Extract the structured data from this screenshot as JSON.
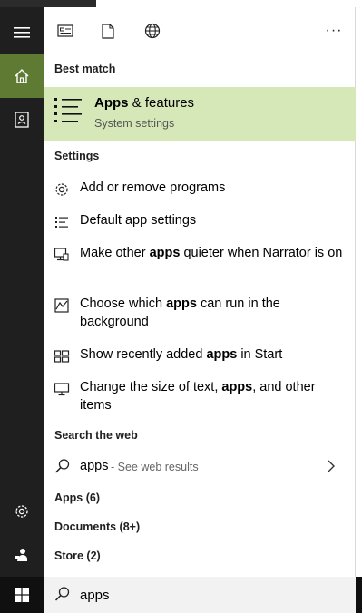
{
  "toolbar": {
    "more_label": "···"
  },
  "best_match": {
    "heading": "Best match",
    "title_bold": "Apps",
    "title_rest": " & features",
    "subtitle": "System settings"
  },
  "settings": {
    "heading": "Settings",
    "items": [
      {
        "parts": [
          "Add or remove programs"
        ]
      },
      {
        "parts": [
          "Default app settings"
        ]
      },
      {
        "pre": "Make other ",
        "bold": "apps",
        "post": " quieter when Narrator is on"
      },
      {
        "pre": "Choose which ",
        "bold": "apps",
        "post": " can run in the background"
      },
      {
        "pre": "Show recently added ",
        "bold": "apps",
        "post": " in Start"
      },
      {
        "pre": "Change the size of text, ",
        "bold": "apps",
        "post": ", and other items"
      }
    ]
  },
  "web": {
    "heading": "Search the web",
    "query": "apps",
    "see_results": " - See web results"
  },
  "categories": {
    "apps": "Apps (6)",
    "documents": "Documents (8+)",
    "store": "Store (2)"
  },
  "search": {
    "value": "apps"
  },
  "colors": {
    "accent": "#5f7a32",
    "best_match_bg": "#d7e8b8",
    "rail_bg": "#1f1f1f"
  }
}
